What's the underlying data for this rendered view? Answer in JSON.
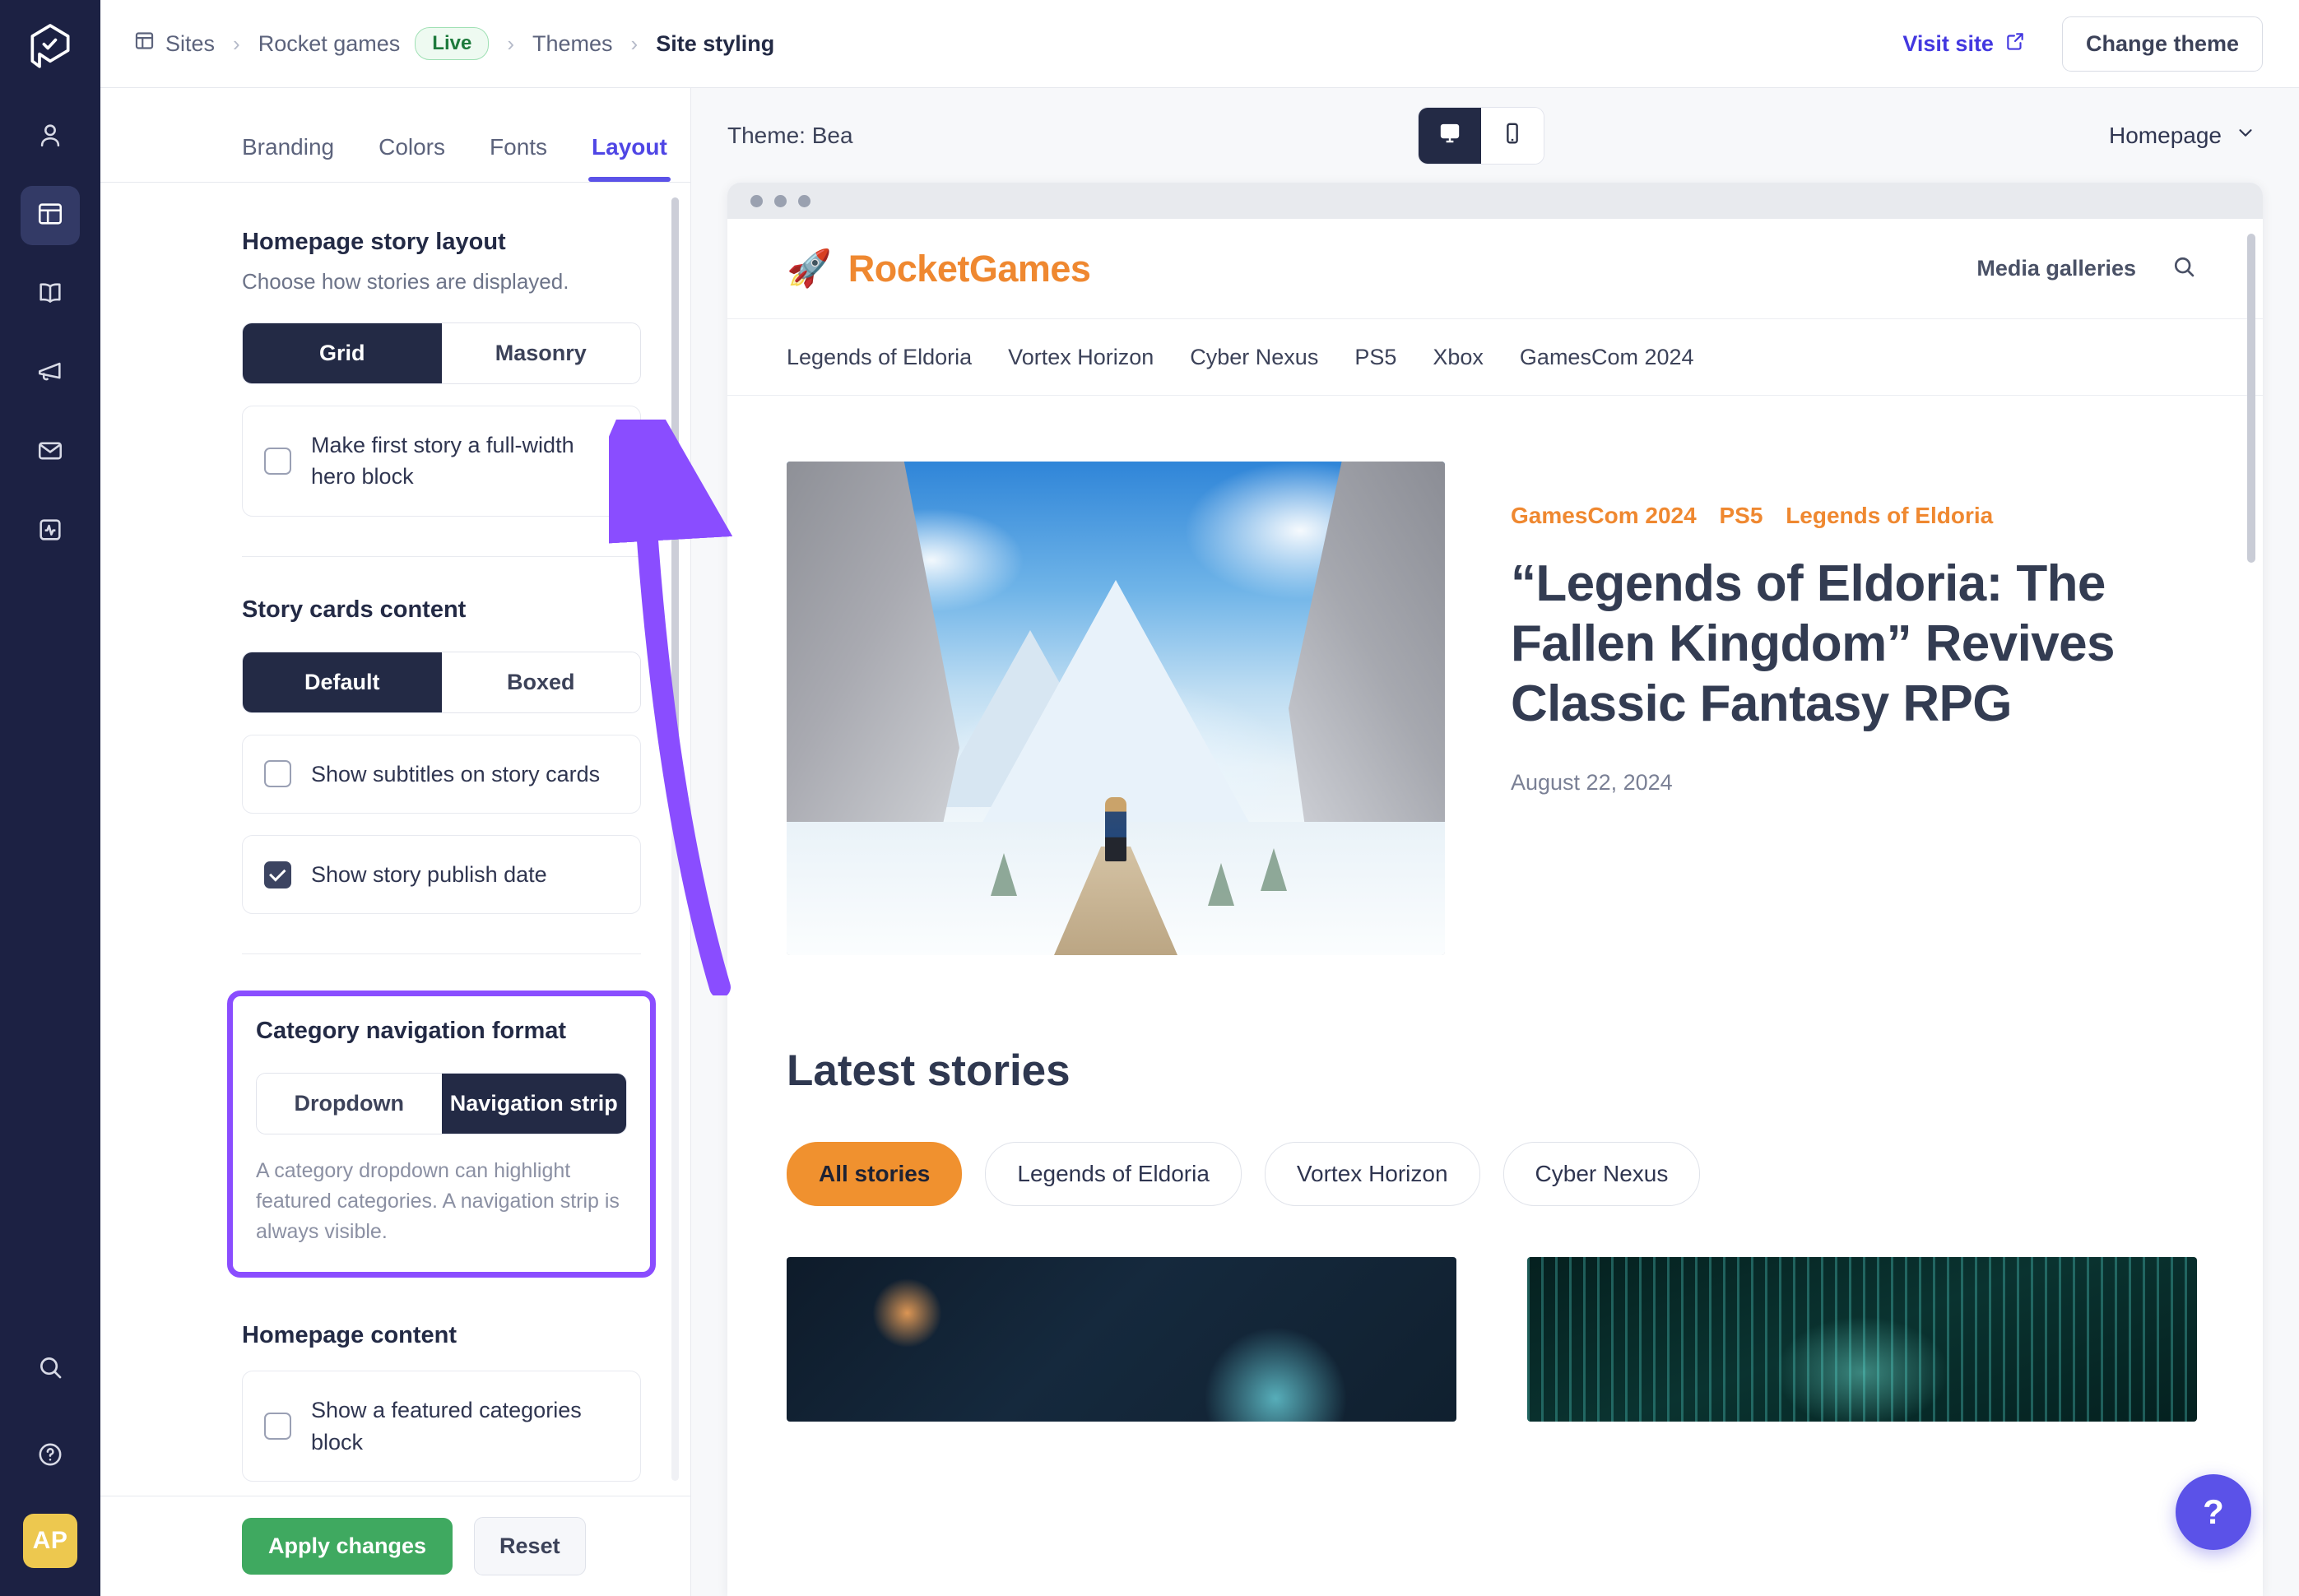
{
  "rail": {
    "logo_icon": "prezly-logo-icon",
    "items": [
      {
        "name": "contacts",
        "icon": "person-icon",
        "active": false
      },
      {
        "name": "sites",
        "icon": "layout-panel-icon",
        "active": true
      },
      {
        "name": "stories",
        "icon": "book-icon",
        "active": false
      },
      {
        "name": "campaigns",
        "icon": "megaphone-icon",
        "active": false
      },
      {
        "name": "emails",
        "icon": "envelope-icon",
        "active": false
      },
      {
        "name": "analytics",
        "icon": "activity-pulse-icon",
        "active": false
      }
    ],
    "bottom": [
      {
        "name": "search",
        "icon": "search-icon"
      },
      {
        "name": "help",
        "icon": "help-circle-icon"
      }
    ],
    "avatar_initials": "AP"
  },
  "topbar": {
    "breadcrumbs": [
      {
        "label": "Sites",
        "icon": "sites-icon"
      },
      {
        "label": "Rocket games",
        "badge": "Live"
      },
      {
        "label": "Themes"
      },
      {
        "label": "Site styling",
        "current": true
      }
    ],
    "separator": "›",
    "visit_site_label": "Visit site",
    "visit_site_icon": "external-link-icon",
    "change_theme_label": "Change theme"
  },
  "panel": {
    "tabs": [
      {
        "label": "Branding",
        "active": false
      },
      {
        "label": "Colors",
        "active": false
      },
      {
        "label": "Fonts",
        "active": false
      },
      {
        "label": "Layout",
        "active": true
      }
    ],
    "sections": {
      "story_layout": {
        "title": "Homepage story layout",
        "subtitle": "Choose how stories are displayed.",
        "segment": {
          "options": [
            "Grid",
            "Masonry"
          ],
          "selected": "Grid"
        },
        "checkbox": {
          "label": "Make first story a full-width hero block",
          "checked": false
        }
      },
      "story_cards": {
        "title": "Story cards content",
        "segment": {
          "options": [
            "Default",
            "Boxed"
          ],
          "selected": "Default"
        },
        "checkboxes": [
          {
            "label": "Show subtitles on story cards",
            "checked": false
          },
          {
            "label": "Show story publish date",
            "checked": true
          }
        ]
      },
      "category_nav": {
        "title": "Category navigation format",
        "segment": {
          "options": [
            "Dropdown",
            "Navigation strip"
          ],
          "selected": "Navigation strip"
        },
        "note": "A category dropdown can highlight featured categories. A navigation strip is always visible.",
        "highlighted": true,
        "highlight_color": "#8a4dff"
      },
      "homepage_content": {
        "title": "Homepage content",
        "checkbox": {
          "label": "Show a featured categories block",
          "checked": false
        }
      }
    },
    "footer": {
      "apply_label": "Apply changes",
      "apply_color": "#3fa960",
      "reset_label": "Reset"
    }
  },
  "preview": {
    "theme_label": "Theme: Bea",
    "device_toggle": {
      "options": [
        {
          "name": "desktop",
          "icon": "monitor-icon",
          "selected": true
        },
        {
          "name": "mobile",
          "icon": "phone-icon",
          "selected": false
        }
      ]
    },
    "page_select": {
      "value": "Homepage",
      "icon": "chevron-down-icon"
    },
    "site": {
      "brand": {
        "mark": "🚀",
        "name": "RocketGames",
        "color": "#ef8830"
      },
      "header_links": [
        "Media galleries"
      ],
      "search_icon": "search-icon",
      "category_strip": [
        "Legends of Eldoria",
        "Vortex Horizon",
        "Cyber Nexus",
        "PS5",
        "Xbox",
        "GamesCom 2024"
      ],
      "hero": {
        "image_alt": "snowy-mountain-valley-fantasy-art",
        "kicker": [
          "GamesCom 2024",
          "PS5",
          "Legends of Eldoria"
        ],
        "headline": "“Legends of Eldoria: The Fallen Kingdom” Revives Classic Fantasy RPG",
        "date": "August 22, 2024"
      },
      "latest": {
        "title": "Latest stories",
        "chips": [
          {
            "label": "All stories",
            "selected": true
          },
          {
            "label": "Legends of Eldoria",
            "selected": false
          },
          {
            "label": "Vortex Horizon",
            "selected": false
          },
          {
            "label": "Cyber Nexus",
            "selected": false
          }
        ],
        "cards": [
          {
            "image_alt": "space-planet-lightspeed-art"
          },
          {
            "image_alt": "cyber-neon-data-corridor-art"
          }
        ]
      }
    },
    "fab": {
      "label": "?",
      "color": "#5b52e8"
    }
  }
}
